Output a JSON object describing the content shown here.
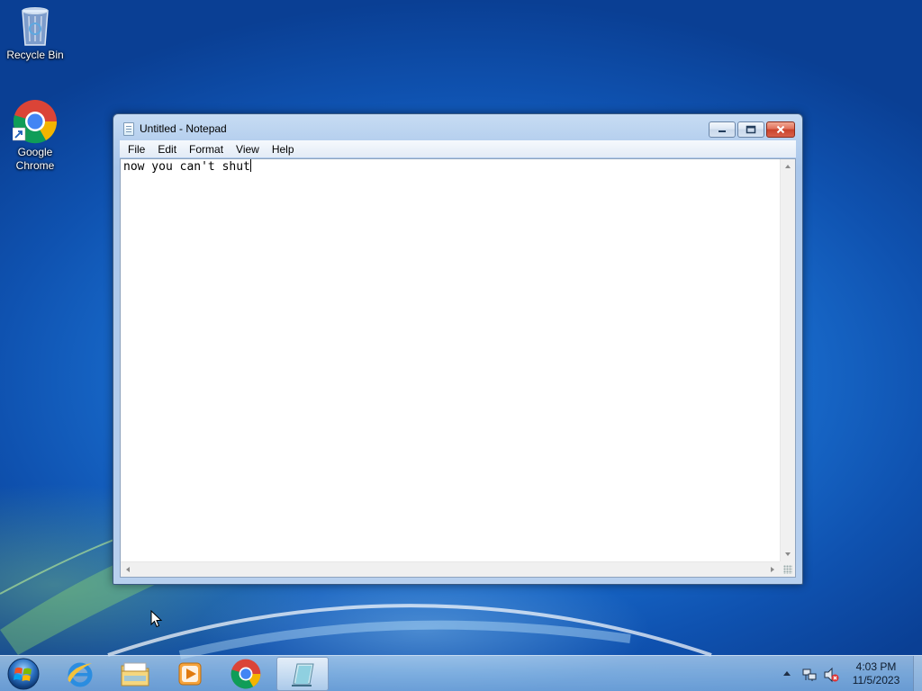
{
  "desktop": {
    "icons": [
      {
        "label": "Recycle Bin",
        "icon": "recycle-bin-icon"
      },
      {
        "label": "Google Chrome",
        "icon": "chrome-icon"
      }
    ]
  },
  "window": {
    "title": "Untitled - Notepad",
    "menu": [
      "File",
      "Edit",
      "Format",
      "View",
      "Help"
    ],
    "content": "now you can't shut",
    "buttons": {
      "minimize": "–",
      "maximize": "□",
      "close": "✕"
    }
  },
  "taskbar": {
    "apps": [
      {
        "icon": "internet-explorer-icon"
      },
      {
        "icon": "file-explorer-icon"
      },
      {
        "icon": "media-player-icon"
      },
      {
        "icon": "chrome-icon"
      },
      {
        "icon": "notepad-icon",
        "active": true
      }
    ],
    "clock": {
      "time": "4:03 PM",
      "date": "11/5/2023"
    }
  },
  "colors": {
    "accent": "#1a6fd0",
    "close": "#c9422a"
  }
}
